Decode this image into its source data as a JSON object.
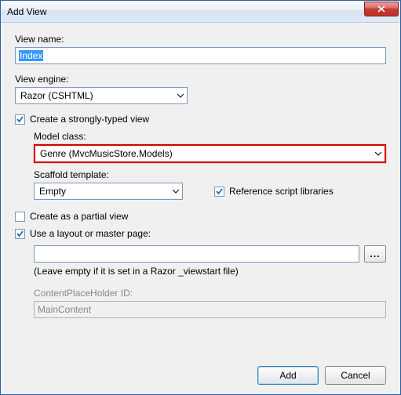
{
  "titlebar": {
    "title": "Add View"
  },
  "viewName": {
    "label": "View name:",
    "value": "Index"
  },
  "viewEngine": {
    "label": "View engine:",
    "value": "Razor (CSHTML)"
  },
  "stronglyTyped": {
    "label": "Create a strongly-typed view",
    "checked": true,
    "modelClass": {
      "label": "Model class:",
      "value": "Genre (MvcMusicStore.Models)"
    },
    "scaffold": {
      "label": "Scaffold template:",
      "value": "Empty"
    },
    "referenceScripts": {
      "label": "Reference script libraries",
      "checked": true
    }
  },
  "partialView": {
    "label": "Create as a partial view",
    "checked": false
  },
  "layout": {
    "label": "Use a layout or master page:",
    "checked": true,
    "path": "",
    "hint": "(Leave empty if it is set in a Razor _viewstart file)",
    "placeholderLabel": "ContentPlaceHolder ID:",
    "placeholderValue": "MainContent"
  },
  "buttons": {
    "add": "Add",
    "cancel": "Cancel",
    "browse": "..."
  }
}
